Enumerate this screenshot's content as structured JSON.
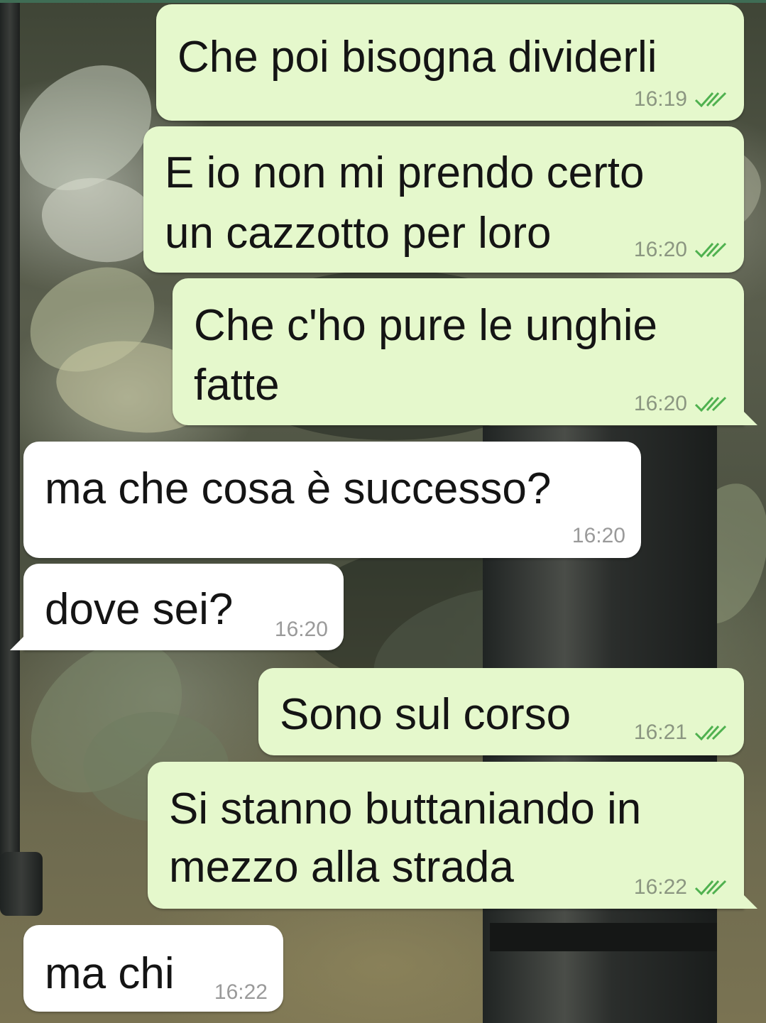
{
  "wallpaper": {
    "description_icon": "garden-photo-wallpaper"
  },
  "colors": {
    "outgoing_bubble": "#e5f8cc",
    "incoming_bubble": "#ffffff",
    "read_ticks": "#4fb14f",
    "timestamp": "#8b9681"
  },
  "messages": [
    {
      "direction": "out",
      "lines": [
        "Che poi bisogna dividerli"
      ],
      "time": "16:19",
      "status": "read"
    },
    {
      "direction": "out",
      "lines": [
        "E io non mi prendo certo",
        "un cazzotto per loro"
      ],
      "time": "16:20",
      "status": "read"
    },
    {
      "direction": "out",
      "lines": [
        "Che c'ho pure le unghie",
        "fatte"
      ],
      "time": "16:20",
      "status": "read"
    },
    {
      "direction": "in",
      "lines": [
        "ma che cosa è successo?"
      ],
      "time": "16:20"
    },
    {
      "direction": "in",
      "lines": [
        "dove sei?"
      ],
      "time": "16:20"
    },
    {
      "direction": "out",
      "lines": [
        "Sono sul corso"
      ],
      "time": "16:21",
      "status": "read"
    },
    {
      "direction": "out",
      "lines": [
        "Si stanno buttaniando in",
        "mezzo alla strada"
      ],
      "time": "16:22",
      "status": "read"
    },
    {
      "direction": "in",
      "lines": [
        "ma chi"
      ],
      "time": "16:22"
    }
  ]
}
